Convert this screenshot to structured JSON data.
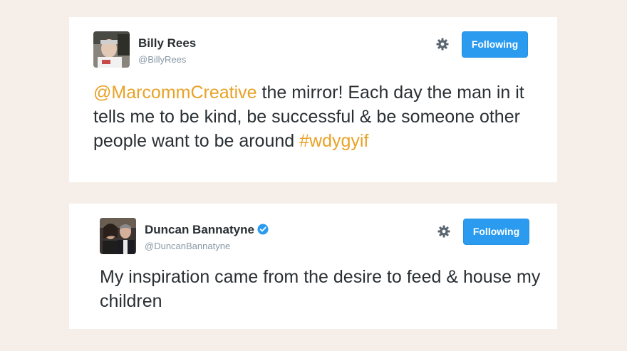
{
  "colors": {
    "background": "#f6efe9",
    "card": "#ffffff",
    "name_text": "#292f33",
    "handle_text": "#8899a6",
    "follow_button": "#2b9bf0",
    "link_accent": "#e8a227",
    "verified_badge": "#2b9bf0"
  },
  "tweets": [
    {
      "name": "Billy Rees",
      "handle": "@BillyRees",
      "verified": false,
      "avatar_icon": "user-avatar-photo",
      "settings_icon": "gear-icon",
      "follow_label": "Following",
      "text_mention": "@MarcommCreative",
      "text_body": " the mirror! Each day the man in it tells me to be kind, be successful & be someone other people want to be around ",
      "text_hashtag": "#wdygyif"
    },
    {
      "name": "Duncan Bannatyne",
      "handle": "@DuncanBannatyne",
      "verified": true,
      "avatar_icon": "user-avatar-photo",
      "verified_icon": "verified-badge-icon",
      "settings_icon": "gear-icon",
      "follow_label": "Following",
      "text_body": "My inspiration came from the desire to feed & house my children"
    }
  ]
}
